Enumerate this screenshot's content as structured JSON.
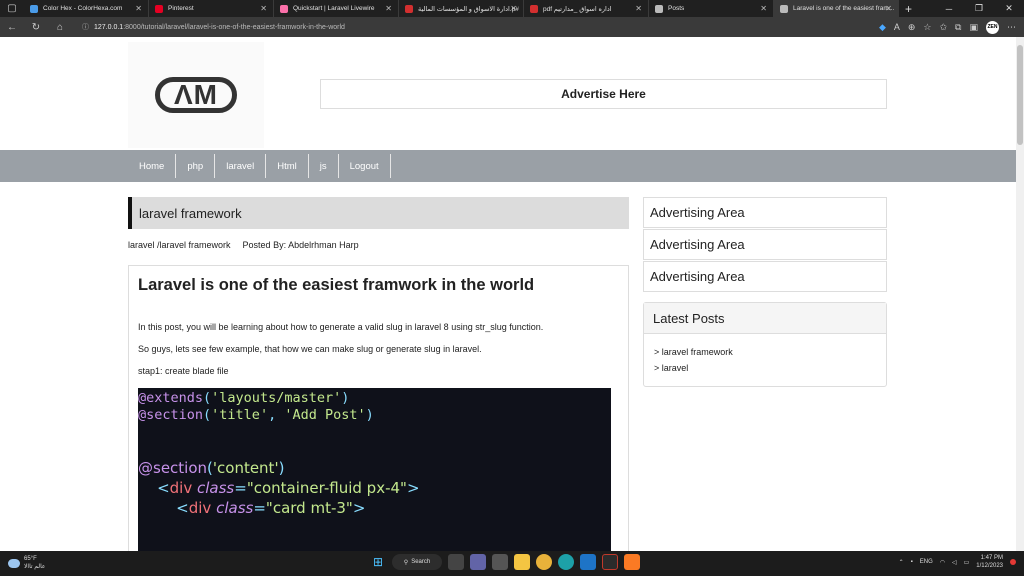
{
  "browser": {
    "tabs": [
      {
        "title": "Color Hex - ColorHexa.com",
        "fav_color": "#4a9be8"
      },
      {
        "title": "Pinterest",
        "fav_color": "#e60023"
      },
      {
        "title": "Quickstart | Laravel Livewire",
        "fav_color": "#fb70a9"
      },
      {
        "title": "ادارة الاسواق و المؤسسات المالية.p#",
        "fav_color": "#d32f2f"
      },
      {
        "title": "pdf اداره اسواق _مدارتيم",
        "fav_color": "#d32f2f"
      },
      {
        "title": "Posts",
        "fav_color": "#bbbbbb"
      },
      {
        "title": "Laravel is one of the easiest fram...",
        "fav_color": "#bbbbbb"
      }
    ],
    "url_host": "127.0.0.1",
    "url_rest": ":8000/tutorial/laravel/laravel-is-one-of-the-easiest-framwork-in-the-world",
    "profile": "ZEN"
  },
  "site": {
    "logo_text": "ΛM",
    "advert": "Advertise Here",
    "menu": [
      "Home",
      "php",
      "laravel",
      "Html",
      "js",
      "Logout"
    ]
  },
  "post": {
    "category": "laravel framework",
    "breadcrumb": "laravel /laravel framework",
    "posted_by": "Posted By: Abdelrhman Harp",
    "title": "Laravel is one of the easiest framwork in the world",
    "para1": "In this post, you will be learning about how to generate a valid slug in laravel 8 using str_slug function.",
    "para2": "So guys, lets see few example, that how we can make slug or generate slug in laravel.",
    "para3": "stap1: create blade file",
    "code": {
      "l1_kw": "@extends",
      "l1_arg": "'layouts/master'",
      "l2_kw": "@section",
      "l2_arg1": "'title'",
      "l2_arg2": "'Add Post'",
      "l3_kw": "@section",
      "l3_arg": "'content'",
      "l4_tag": "div",
      "l4_attr": "class",
      "l4_val": "\"container-fluid px-4\"",
      "l5_tag": "div",
      "l5_attr": "class",
      "l5_val": "\"card mt-3\""
    }
  },
  "sidebar": {
    "ads": [
      "Advertising Area",
      "Advertising Area",
      "Advertising Area"
    ],
    "latest_title": "Latest Posts",
    "latest": [
      "> laravel framework",
      "> laravel"
    ]
  },
  "taskbar": {
    "temp": "65°F",
    "weather_text": "عالم تاالا",
    "search": "Search",
    "lang": "ENG",
    "time": "1:47 PM",
    "date": "1/12/2023"
  }
}
